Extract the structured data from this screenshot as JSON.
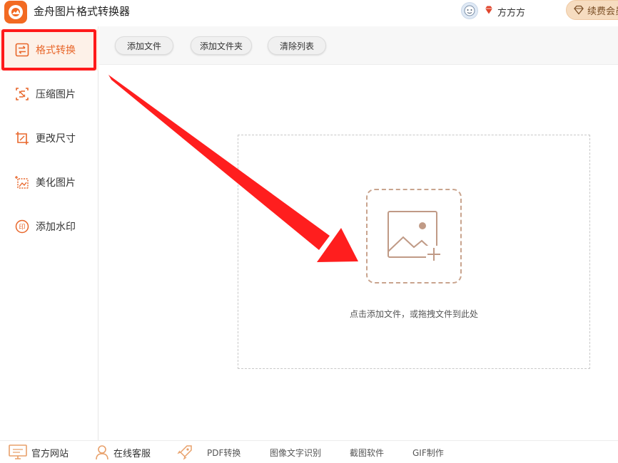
{
  "app": {
    "title": "金舟图片格式转换器"
  },
  "user": {
    "name": "方方方",
    "renew_label": "续费会员"
  },
  "sidebar": {
    "items": [
      {
        "label": "格式转换",
        "icon": "convert-icon",
        "active": true
      },
      {
        "label": "压缩图片",
        "icon": "compress-icon",
        "active": false
      },
      {
        "label": "更改尺寸",
        "icon": "resize-icon",
        "active": false
      },
      {
        "label": "美化图片",
        "icon": "beautify-icon",
        "active": false
      },
      {
        "label": "添加水印",
        "icon": "watermark-icon",
        "active": false
      }
    ]
  },
  "toolbar": {
    "add_file": "添加文件",
    "add_folder": "添加文件夹",
    "clear_list": "清除列表"
  },
  "dropzone": {
    "hint": "点击添加文件，或拖拽文件到此处",
    "icon": "add-image-icon"
  },
  "bottom": {
    "website": "官方网站",
    "support": "在线客服",
    "pdf": "PDF转换",
    "ocr": "图像文字识别",
    "screenshot": "截图软件",
    "gif": "GIF制作"
  },
  "colors": {
    "accent": "#e8662a",
    "annotation_red": "#ff1a1a",
    "renew_bg": "#f6dcc0"
  }
}
